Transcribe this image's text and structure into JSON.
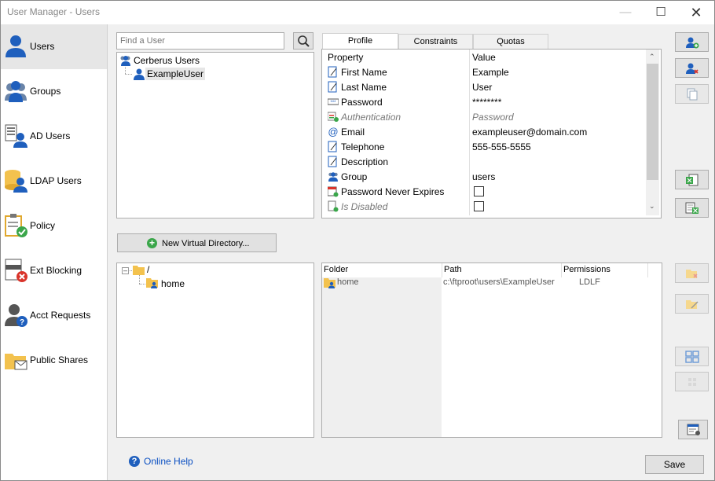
{
  "window": {
    "title": "User Manager - Users"
  },
  "sidebar": {
    "items": [
      {
        "label": "Users",
        "icon": "user-icon",
        "active": true
      },
      {
        "label": "Groups",
        "icon": "groups-icon"
      },
      {
        "label": "AD Users",
        "icon": "ad-users-icon"
      },
      {
        "label": "LDAP Users",
        "icon": "ldap-users-icon"
      },
      {
        "label": "Policy",
        "icon": "policy-icon"
      },
      {
        "label": "Ext Blocking",
        "icon": "ext-blocking-icon"
      },
      {
        "label": "Acct Requests",
        "icon": "acct-requests-icon"
      },
      {
        "label": "Public Shares",
        "icon": "public-shares-icon"
      }
    ]
  },
  "search": {
    "placeholder": "Find a User"
  },
  "user_tree": {
    "root": "Cerberus Users",
    "child": "ExampleUser"
  },
  "tabs": [
    "Profile",
    "Constraints",
    "Quotas"
  ],
  "profile": {
    "header_property": "Property",
    "header_value": "Value",
    "rows": [
      {
        "name": "First Name",
        "value": "Example"
      },
      {
        "name": "Last Name",
        "value": "User"
      },
      {
        "name": "Password",
        "value": "********"
      },
      {
        "name": "Authentication",
        "value": "Password"
      },
      {
        "name": "Email",
        "value": "exampleuser@domain.com"
      },
      {
        "name": "Telephone",
        "value": "555-555-5555"
      },
      {
        "name": "Description",
        "value": ""
      },
      {
        "name": "Group",
        "value": "users"
      },
      {
        "name": "Password Never Expires",
        "value": ""
      },
      {
        "name": "Is Disabled",
        "value": ""
      }
    ]
  },
  "new_dir_label": "New Virtual Directory...",
  "dir_tree": {
    "root": "/",
    "child": "home"
  },
  "folders": {
    "headers": {
      "folder": "Folder",
      "path": "Path",
      "permissions": "Permissions"
    },
    "rows": [
      {
        "folder": "home",
        "path": "c:\\ftproot\\users\\ExampleUser",
        "permissions": "LDLF"
      }
    ]
  },
  "help_label": "Online Help",
  "save_label": "Save",
  "colors": {
    "accent_blue": "#1f5fbd",
    "folder_yellow": "#f3c24e",
    "green": "#3aa64a",
    "red": "#d9342b"
  }
}
